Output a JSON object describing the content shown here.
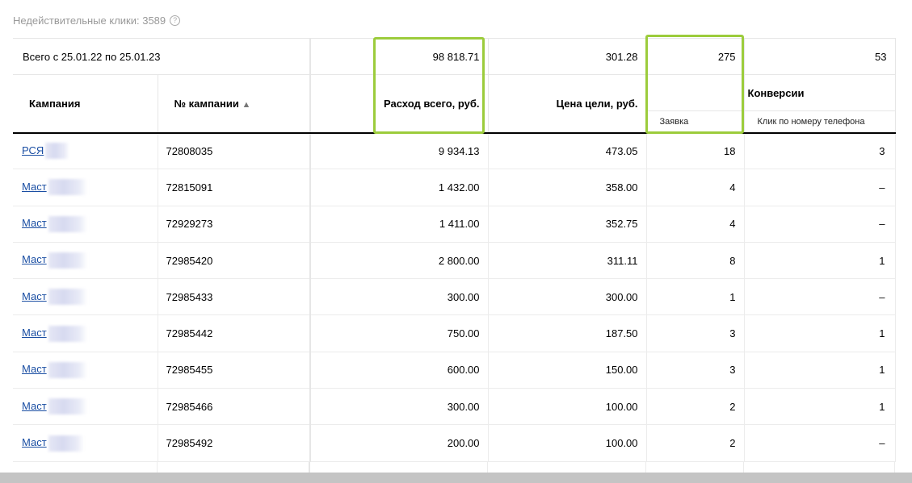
{
  "invalid_clicks": {
    "label": "Недействительные клики: 3589",
    "help_icon": "?"
  },
  "totals": {
    "period_label": "Всего с 25.01.22 по 25.01.23",
    "spend": "98 818.71",
    "goal_price": "301.28",
    "leads": "275",
    "phone_clicks": "53"
  },
  "headers": {
    "campaign": "Кампания",
    "campaign_id": "№ кампании",
    "sort_indicator": "▲",
    "spend": "Расход всего, руб.",
    "goal_price": "Цена цели, руб.",
    "conversions": "Конверсии",
    "lead": "Заявка",
    "phone_click": "Клик по номеру телефона"
  },
  "rows": [
    {
      "name": "РСЯ",
      "id": "72808035",
      "spend": "9 934.13",
      "goal_price": "473.05",
      "leads": "18",
      "phone": "3"
    },
    {
      "name": "Маст",
      "id": "72815091",
      "spend": "1 432.00",
      "goal_price": "358.00",
      "leads": "4",
      "phone": "–"
    },
    {
      "name": "Маст",
      "id": "72929273",
      "spend": "1 411.00",
      "goal_price": "352.75",
      "leads": "4",
      "phone": "–"
    },
    {
      "name": "Маст",
      "id": "72985420",
      "spend": "2 800.00",
      "goal_price": "311.11",
      "leads": "8",
      "phone": "1"
    },
    {
      "name": "Маст",
      "id": "72985433",
      "spend": "300.00",
      "goal_price": "300.00",
      "leads": "1",
      "phone": "–"
    },
    {
      "name": "Маст",
      "id": "72985442",
      "spend": "750.00",
      "goal_price": "187.50",
      "leads": "3",
      "phone": "1"
    },
    {
      "name": "Маст",
      "id": "72985455",
      "spend": "600.00",
      "goal_price": "150.00",
      "leads": "3",
      "phone": "1"
    },
    {
      "name": "Маст",
      "id": "72985466",
      "spend": "300.00",
      "goal_price": "100.00",
      "leads": "2",
      "phone": "1"
    },
    {
      "name": "Маст",
      "id": "72985492",
      "spend": "200.00",
      "goal_price": "100.00",
      "leads": "2",
      "phone": "–"
    }
  ],
  "colors": {
    "highlight": "#9ccc3c",
    "link": "#1a4ea3",
    "muted_text": "#999999"
  }
}
